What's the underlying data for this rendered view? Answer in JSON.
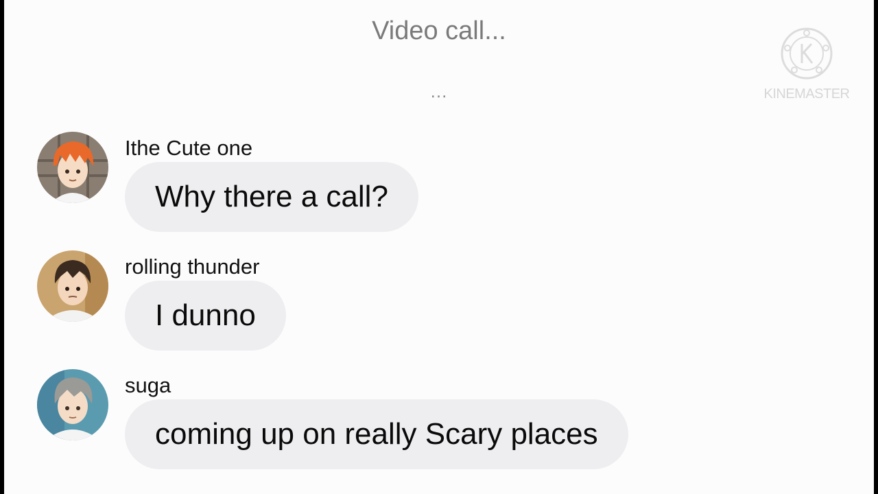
{
  "header": {
    "title": "Video call...",
    "typing_indicator": "..."
  },
  "watermark": {
    "logo_icon": "kinemaster-logo-icon",
    "text": "KINEMASTER"
  },
  "messages": [
    {
      "sender": "Ithe Cute one",
      "text": "Why there a call?",
      "avatar_icon": "orange-hair-avatar-icon"
    },
    {
      "sender": "rolling thunder",
      "text": "I dunno",
      "avatar_icon": "dark-hair-avatar-icon"
    },
    {
      "sender": "suga",
      "text": "coming up on really Scary places",
      "avatar_icon": "grey-hair-avatar-icon"
    }
  ],
  "colors": {
    "background": "#fdfcfd",
    "bubble": "#eeedef",
    "title_text": "#7a7a7a",
    "watermark": "#d6d6d6"
  }
}
